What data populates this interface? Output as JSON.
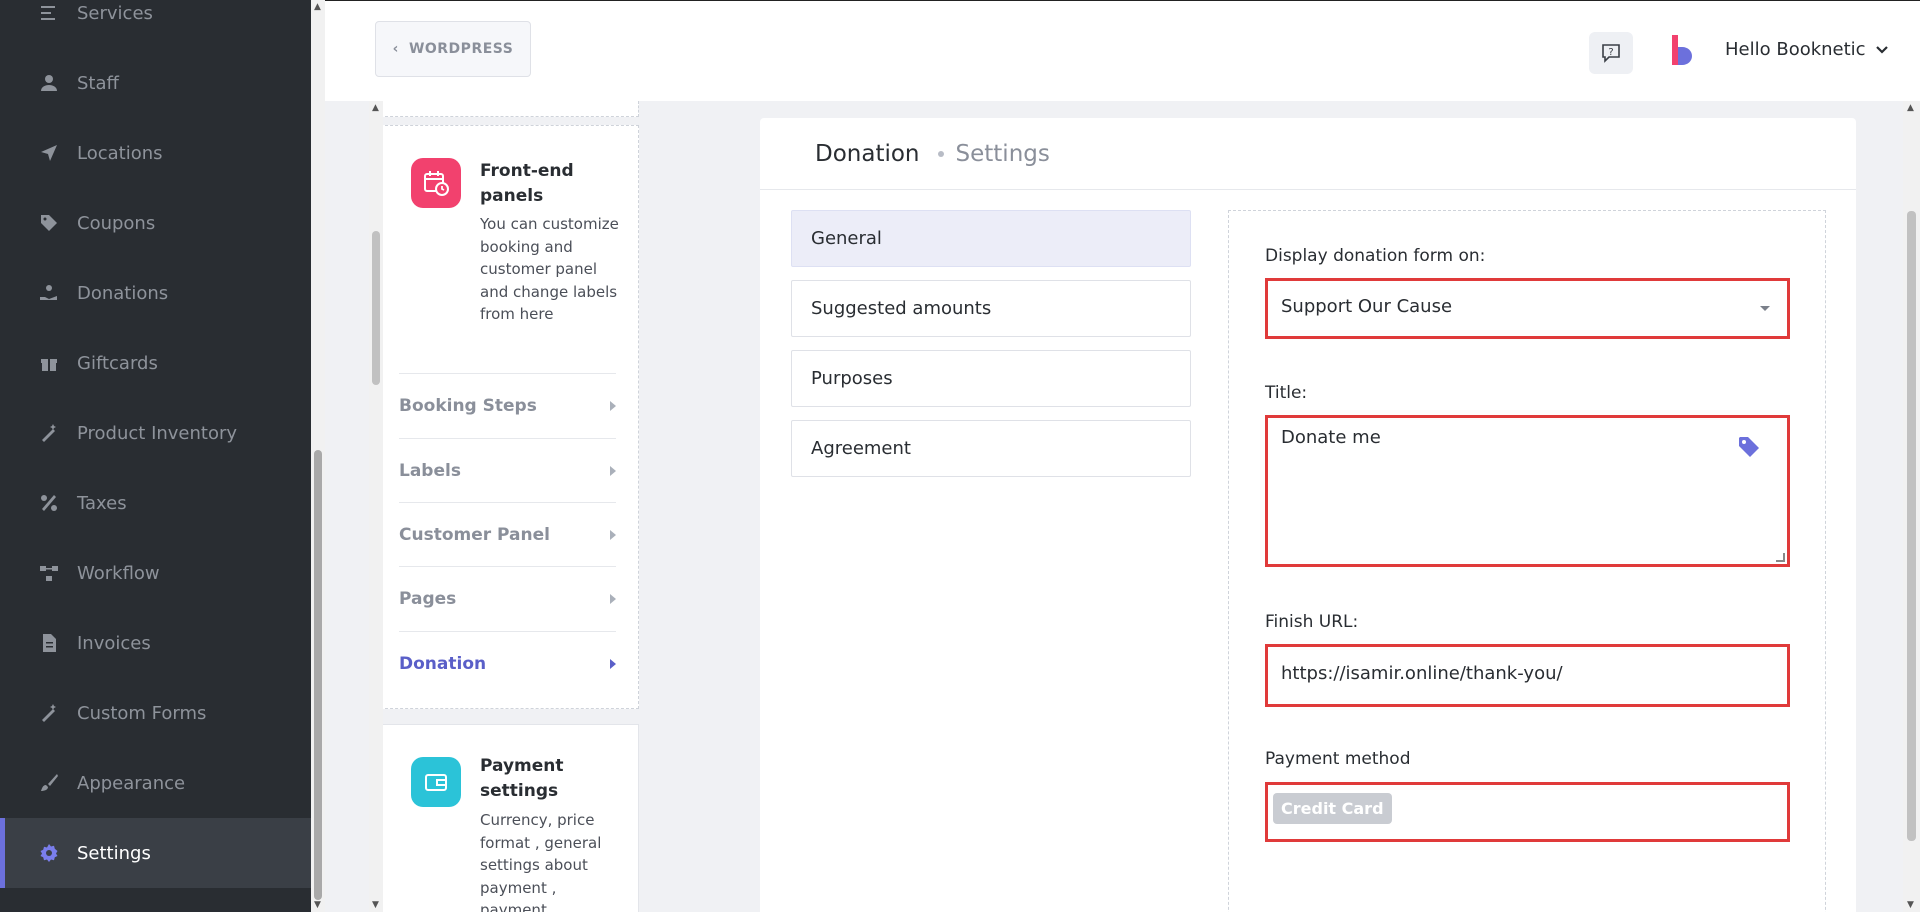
{
  "sidebar": {
    "items": [
      {
        "label": "Services",
        "icon": "services-icon"
      },
      {
        "label": "Staff",
        "icon": "staff-icon"
      },
      {
        "label": "Locations",
        "icon": "location-arrow-icon"
      },
      {
        "label": "Coupons",
        "icon": "tag-icon"
      },
      {
        "label": "Donations",
        "icon": "donation-hand-icon"
      },
      {
        "label": "Giftcards",
        "icon": "gift-icon"
      },
      {
        "label": "Product Inventory",
        "icon": "magic-wand-icon"
      },
      {
        "label": "Taxes",
        "icon": "percent-icon"
      },
      {
        "label": "Workflow",
        "icon": "workflow-icon"
      },
      {
        "label": "Invoices",
        "icon": "file-invoice-icon"
      },
      {
        "label": "Custom Forms",
        "icon": "magic-wand-icon"
      },
      {
        "label": "Appearance",
        "icon": "brush-icon"
      },
      {
        "label": "Settings",
        "icon": "gear-icon",
        "active": true
      }
    ]
  },
  "header": {
    "back_label": "WORDPRESS",
    "user_greeting": "Hello Booknetic"
  },
  "settings_menu": {
    "front_end": {
      "title": "Front-end panels",
      "description": "You can customize booking and customer panel and change labels from here",
      "icon_color": "#f2416e",
      "items": [
        {
          "label": "Booking Steps"
        },
        {
          "label": "Labels"
        },
        {
          "label": "Customer Panel"
        },
        {
          "label": "Pages"
        },
        {
          "label": "Donation",
          "active": true
        }
      ]
    },
    "payment": {
      "title": "Payment settings",
      "description": "Currency, price format , general settings about payment , payment",
      "icon_color": "#2bc3d8"
    }
  },
  "panel": {
    "title": "Donation",
    "subtitle": "Settings",
    "tabs": [
      {
        "label": "General",
        "active": true
      },
      {
        "label": "Suggested amounts"
      },
      {
        "label": "Purposes"
      },
      {
        "label": "Agreement"
      }
    ],
    "form": {
      "display_label": "Display donation form on:",
      "display_value": "Support Our Cause",
      "title_label": "Title:",
      "title_value": "Donate me",
      "finish_url_label": "Finish URL:",
      "finish_url_value": "https://isamir.online/thank-you/",
      "payment_label": "Payment method",
      "payment_chip": "Credit Card"
    }
  },
  "colors": {
    "highlight_border": "#e03a3a",
    "accent": "#6c70dc",
    "sidebar_bg": "#292d32"
  }
}
